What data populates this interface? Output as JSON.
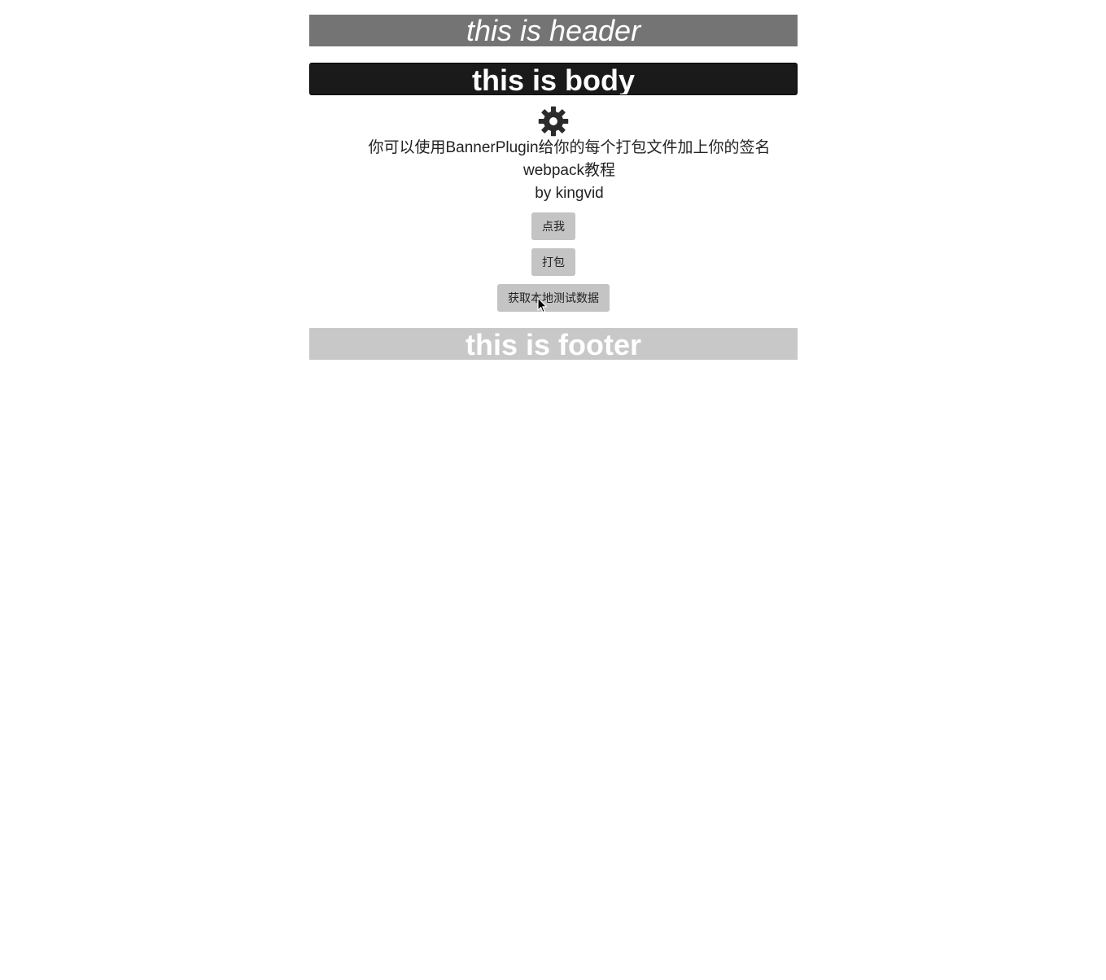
{
  "header": {
    "text": "this is header"
  },
  "body_bar": {
    "text": "this is body"
  },
  "gear": {
    "icon": "gear-icon"
  },
  "content": {
    "line1": "你可以使用BannerPlugin给你的每个打包文件加上你的签名",
    "line2": "webpack教程",
    "line3": "by kingvid"
  },
  "buttons": {
    "click_me": "点我",
    "bundle": "打包",
    "get_local_data": "获取本地测试数据"
  },
  "footer": {
    "text": "this is footer"
  }
}
